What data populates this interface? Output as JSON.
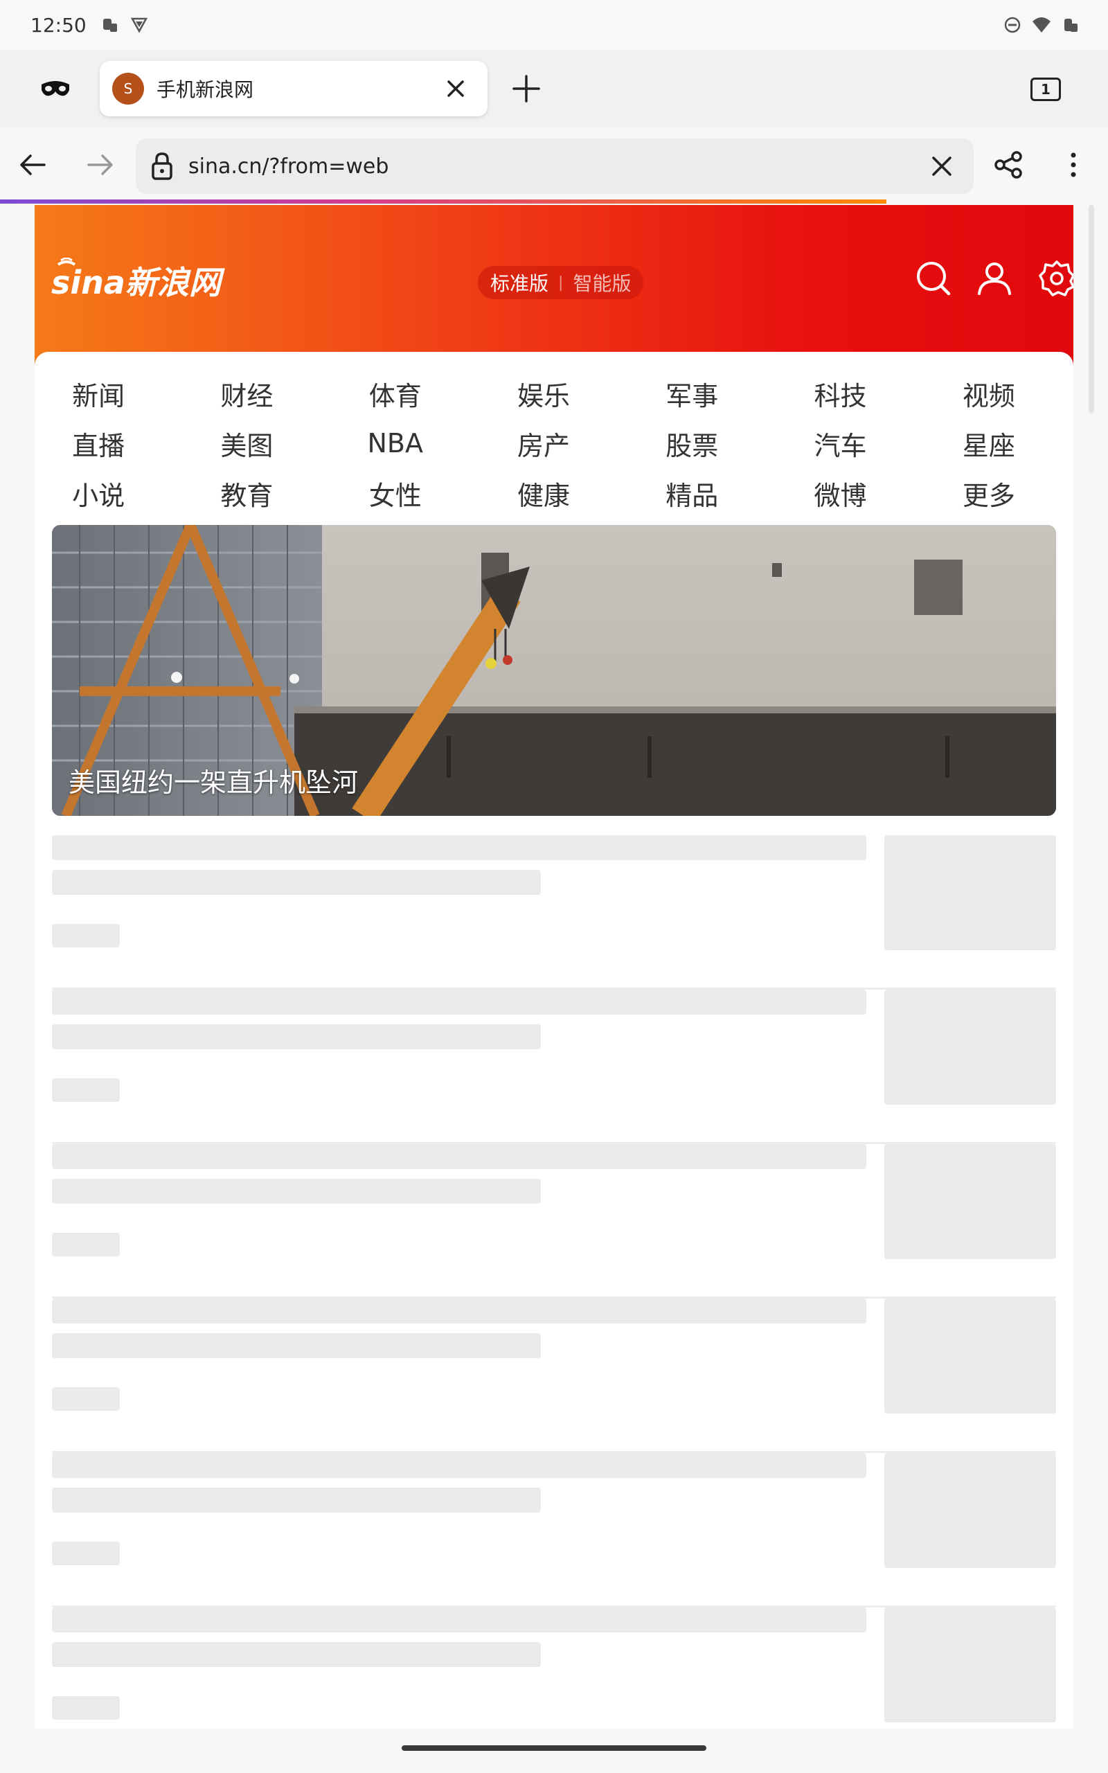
{
  "status_bar": {
    "time": "12:50"
  },
  "tabs": {
    "active_title": "手机新浪网",
    "favicon_letter": "S",
    "tab_count": "1"
  },
  "address_bar": {
    "url": "sina.cn/?from=web"
  },
  "header": {
    "logo_text": "sina新浪网",
    "version_active": "标准版",
    "version_separator": "|",
    "version_inactive": "智能版"
  },
  "nav": {
    "items": [
      "新闻",
      "财经",
      "体育",
      "娱乐",
      "军事",
      "科技",
      "视频",
      "直播",
      "美图",
      "NBA",
      "房产",
      "股票",
      "汽车",
      "星座",
      "小说",
      "教育",
      "女性",
      "健康",
      "精品",
      "微博",
      "更多"
    ]
  },
  "hero": {
    "caption": "美国纽约一架直升机坠河"
  },
  "colors": {
    "header_start": "#f57a18",
    "header_end": "#e0080c",
    "skeleton": "#ebebeb"
  }
}
